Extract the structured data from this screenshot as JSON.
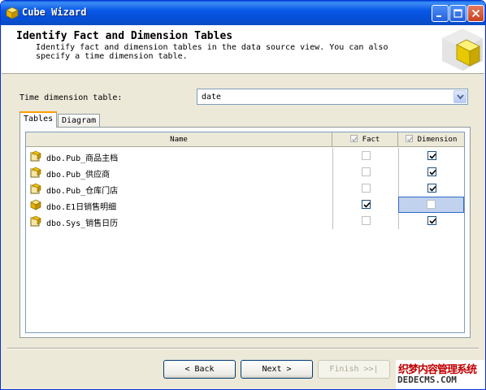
{
  "window": {
    "title": "Cube Wizard"
  },
  "header": {
    "title": "Identify Fact and Dimension Tables",
    "description": "Identify fact and dimension tables in the data source view. You can also specify a time dimension table."
  },
  "time_dimension": {
    "label": "Time dimension table:",
    "value": "date"
  },
  "tabs": [
    {
      "label": "Tables",
      "active": true
    },
    {
      "label": "Diagram",
      "active": false
    }
  ],
  "grid": {
    "columns": {
      "name": "Name",
      "fact": "Fact",
      "dimension": "Dimension"
    },
    "rows": [
      {
        "name": "dbo.Pub_商品主档",
        "fact": false,
        "dimension": true,
        "icon": "dimension-table-icon"
      },
      {
        "name": "dbo.Pub_供应商",
        "fact": false,
        "dimension": true,
        "icon": "dimension-table-icon"
      },
      {
        "name": "dbo.Pub_仓库门店",
        "fact": false,
        "dimension": true,
        "icon": "dimension-table-icon"
      },
      {
        "name": "dbo.E1日销售明细",
        "fact": true,
        "dimension": false,
        "icon": "fact-table-icon"
      },
      {
        "name": "dbo.Sys_销售日历",
        "fact": false,
        "dimension": true,
        "icon": "dimension-table-icon"
      }
    ]
  },
  "buttons": {
    "back": "< Back",
    "next": "Next >",
    "finish": "Finish >>|"
  },
  "watermark": {
    "line1": "织梦内容管理系统",
    "line2": "DEDECMS.COM"
  },
  "colors": {
    "titlebar": "#0858e8",
    "selection": "#c1d2ee",
    "accent_tab": "#ff9d00"
  }
}
